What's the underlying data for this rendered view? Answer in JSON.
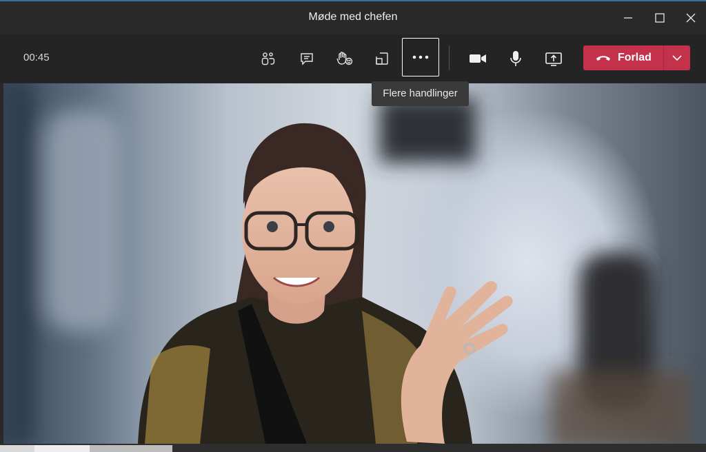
{
  "window": {
    "title": "Møde med chefen",
    "controls": [
      "minimize-icon",
      "maximize-icon",
      "close-icon"
    ]
  },
  "toolbar": {
    "timer": "00:45",
    "buttons": [
      {
        "name": "people-icon",
        "label": "Deltagere"
      },
      {
        "name": "chat-icon",
        "label": "Chat"
      },
      {
        "name": "reactions-icon",
        "label": "Reaktioner"
      },
      {
        "name": "rooms-icon",
        "label": "Grupperum"
      },
      {
        "name": "more-actions-icon",
        "label": "Flere handlinger",
        "active": true
      },
      {
        "name": "camera-icon",
        "label": "Kamera"
      },
      {
        "name": "mic-icon",
        "label": "Mikrofon"
      },
      {
        "name": "share-icon",
        "label": "Del"
      }
    ],
    "leave_label": "Forlad",
    "leave_color": "#c4314b"
  },
  "tooltip": {
    "text": "Flere handlinger"
  },
  "video": {
    "description_icon": "participant-video-feed"
  }
}
